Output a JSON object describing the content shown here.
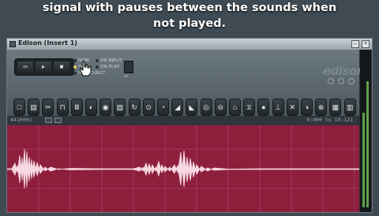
{
  "caption": {
    "line1": "signal with pauses between the sounds when",
    "line2": "not played."
  },
  "window": {
    "title": "Edison (Insert 1)",
    "controls": [
      "minimize",
      "close"
    ]
  },
  "transport": {
    "buttons": [
      {
        "icon": "loop-icon",
        "glyph": "∞"
      },
      {
        "icon": "play-icon",
        "glyph": "▸"
      },
      {
        "icon": "stop-icon",
        "glyph": "■"
      }
    ]
  },
  "record_options": [
    {
      "label": "NOW",
      "active": false
    },
    {
      "label": "SAVE",
      "active": true
    },
    {
      "label": "IN PROJECT",
      "active": false
    },
    {
      "label": "ON INPUT",
      "active": false
    },
    {
      "label": "ON PLAY",
      "active": false
    }
  ],
  "knob_label": "RE",
  "logo": "edison",
  "toolbar": {
    "tools": [
      "new-icon",
      "save-icon",
      "cut-icon",
      "trim-icon",
      "scissors-icon",
      "normalize-icon",
      "amplify-icon",
      "fade-icon",
      "reverse-icon",
      "denoise-icon",
      "blur-icon",
      "envelope-icon",
      "equalizer-icon",
      "convolve-icon",
      "mark-icon",
      "slice-icon",
      "stretch-icon",
      "drop-icon",
      "tune-icon",
      "spectrum-icon",
      "grid-icon",
      "loop-tool-icon",
      "copy-icon",
      "export-icon"
    ]
  },
  "info": {
    "sample_rate": "44100Hz",
    "range": "0:000 to 19:121"
  },
  "colors": {
    "wave_bg": "#8d1f3d",
    "wave_fg": "#f6d7e2",
    "meter": "#5ea24b"
  }
}
